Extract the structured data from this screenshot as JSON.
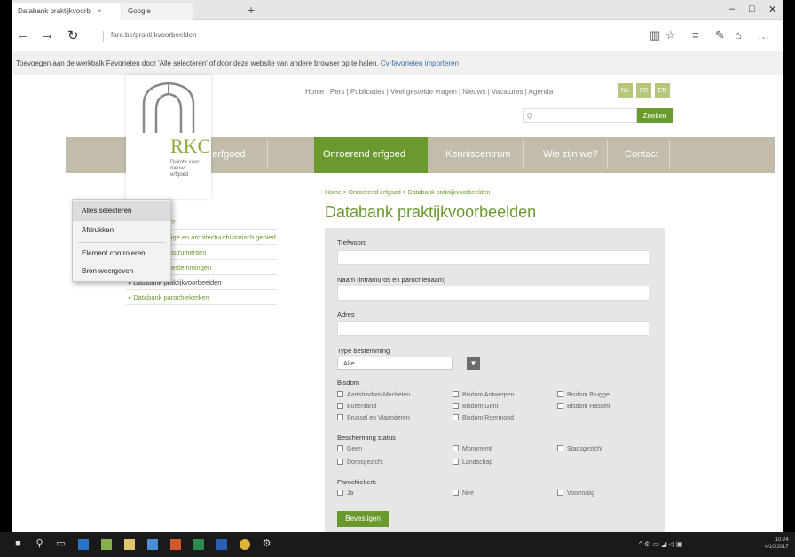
{
  "browser": {
    "tabs": [
      {
        "label": "Databank praktijkvoorb",
        "close": "×"
      },
      {
        "label": "Google",
        "close": ""
      }
    ],
    "new_tab": "+",
    "window_controls": [
      "–",
      "□",
      "✕"
    ],
    "nav": {
      "back": "←",
      "forward": "→",
      "refresh": "↻"
    },
    "url": "faro.be/praktijkvoorbeelden",
    "tools": [
      "▥",
      "☆",
      "≡",
      "✎",
      "⌂",
      "…"
    ]
  },
  "notice": {
    "text": "Toevoegen aan de werkbalk Favorieten door 'Alle selecteren' of door deze website van andere browser op te halen.",
    "link": "Cv-favorieten importeren"
  },
  "site": {
    "logo_text": "RKC",
    "logo_sub": "Ruimte voor\nnieuw\nerfgoed",
    "toplinks": "Home | Pers | Publicaties | Veel gestelde vragen | Nieuws | Vacatures | Agenda",
    "languages": [
      "NL",
      "FR",
      "EN"
    ],
    "search_placeholder": "Q",
    "search_button": "Zoeken",
    "nav": [
      "Roerend erfgoed",
      "Onroerend erfgoed",
      "Kenniscentrum",
      "Wie zijn we?",
      "Contact"
    ]
  },
  "leftmenu": [
    "» Wat doen wij?",
    "» Erfgoedkundige en architectuurhistorisch gebied",
    "» Erfgoed en instrumenten",
    "» Erfgoed en bestemmingen",
    "» Databank praktijkvoorbeelden",
    "» Databank parochiekerken"
  ],
  "main": {
    "breadcrumb": "Home > Onroerend erfgoed > Databank praktijkvoorbeelden",
    "title": "Databank praktijkvoorbeelden",
    "form": {
      "fields": [
        "Trefwoord",
        "Naam (intramuros en parochienaam)",
        "Adres"
      ],
      "type_label": "Type bestemming",
      "type_value": "Alle",
      "type_button": "▼",
      "bisdom_label": "Bisdom",
      "bisdom": [
        "Aartsbisdom Mechelen",
        "Bisdom Antwerpen",
        "Bisdom Brugge",
        "Bisdom Gent",
        "Bisdom Hasselt",
        "Bisdom Roermond",
        "Brussel en Vlaanderen",
        "Buitenland"
      ],
      "status_label": "Bescherming status",
      "status": [
        "Geen",
        "Monument",
        "Stadsgezicht",
        "Dorpsgezicht",
        "Landschap"
      ],
      "parish_label": "Parochiekerk",
      "parish": [
        "Ja",
        "Nee",
        "Voormalig"
      ],
      "submit": "Bevestigen"
    }
  },
  "context_menu": [
    "Alles selecteren",
    "Afdrukken",
    "Element controleren",
    "Bron weergeven"
  ],
  "taskbar": {
    "icons": [
      "windows-icon",
      "search-icon",
      "task-view-icon",
      "edge-icon",
      "store-icon",
      "explorer-icon",
      "mail-icon",
      "powerpoint-icon",
      "excel-icon",
      "word-icon",
      "chrome-icon",
      "settings-icon"
    ],
    "tray": "^ ⚙ ▭ ◢ ◁ ▣",
    "time": "10:24",
    "date": "4/10/2017"
  }
}
